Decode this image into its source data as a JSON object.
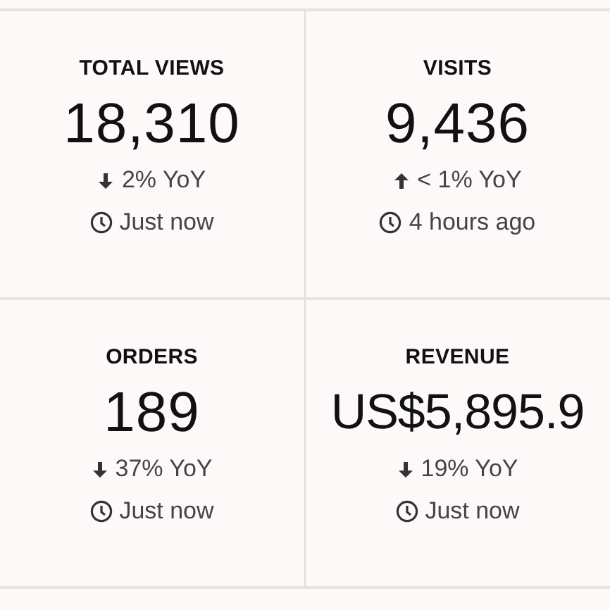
{
  "metrics": [
    {
      "label": "TOTAL VIEWS",
      "value": "18,310",
      "kind": "down",
      "change": "2% YoY",
      "updated": "Just now"
    },
    {
      "label": "VISITS",
      "value": "9,436",
      "kind": "up",
      "change": "< 1% YoY",
      "updated": "4 hours ago"
    },
    {
      "label": "ORDERS",
      "value": "189",
      "kind": "down",
      "change": "37% YoY",
      "updated": "Just now"
    },
    {
      "label": "REVENUE",
      "value": "US$5,895.9",
      "kind": "down",
      "change": "19% YoY",
      "updated": "Just now"
    }
  ]
}
